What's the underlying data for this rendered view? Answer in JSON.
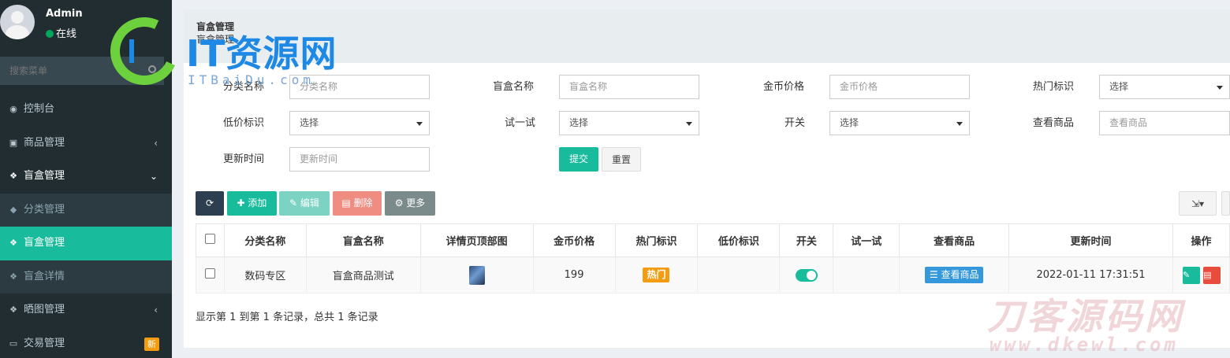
{
  "user": {
    "name": "Admin",
    "status": "在线"
  },
  "sidebar": {
    "search_placeholder": "搜索菜单",
    "items": [
      {
        "label": "控制台",
        "icon": "dashboard-icon"
      },
      {
        "label": "商品管理",
        "icon": "shopping-bag-icon"
      },
      {
        "label": "盲盒管理",
        "icon": "dropbox-icon"
      },
      {
        "label": "分类管理",
        "icon": "tags-icon"
      },
      {
        "label": "盲盒管理",
        "icon": "dropbox-icon"
      },
      {
        "label": "盲盒详情",
        "icon": "dropbox-icon"
      },
      {
        "label": "晒图管理",
        "icon": "dropbox-icon"
      },
      {
        "label": "交易管理",
        "icon": "cart-icon",
        "badge": "新"
      }
    ]
  },
  "header": {
    "title": "盲盒管理",
    "subtitle": "盲盒管理"
  },
  "filters": {
    "category_label": "分类名称",
    "category_placeholder": "分类名称",
    "box_label": "盲盒名称",
    "box_placeholder": "盲盒名称",
    "price_label": "金币价格",
    "price_placeholder": "金币价格",
    "hot_label": "热门标识",
    "hot_value": "选择",
    "lowprice_label": "低价标识",
    "lowprice_value": "选择",
    "try_label": "试一试",
    "try_value": "选择",
    "switch_label": "开关",
    "switch_value": "选择",
    "view_label": "查看商品",
    "view_placeholder": "查看商品",
    "updated_label": "更新时间",
    "updated_placeholder": "更新时间",
    "submit": "提交",
    "reset": "重置"
  },
  "toolbar": {
    "add": "添加",
    "edit": "编辑",
    "delete": "删除",
    "more": "更多"
  },
  "table": {
    "columns": [
      "分类名称",
      "盲盒名称",
      "详情页顶部图",
      "金币价格",
      "热门标识",
      "低价标识",
      "开关",
      "试一试",
      "查看商品",
      "更新时间",
      "操作"
    ],
    "rows": [
      {
        "category": "数码专区",
        "name": "盲盒商品测试",
        "price": "199",
        "hot": "热门",
        "low": "",
        "switch": "on",
        "try": "",
        "view": "查看商品",
        "updated": "2022-01-11 17:31:51"
      }
    ]
  },
  "pager": {
    "summary": "显示第 1 到第 1 条记录，总共 1 条记录"
  },
  "watermarks": {
    "logo_text": "IT资源网",
    "logo_sub": "ITBaiDu.com",
    "corner_text": "刀客源码网",
    "corner_sub": "www.dkewl.com"
  },
  "colors": {
    "sidebar": "#222d32",
    "accent": "#18bc9c",
    "hot": "#f39c12",
    "view": "#3498db",
    "delete": "#e74c3c"
  }
}
